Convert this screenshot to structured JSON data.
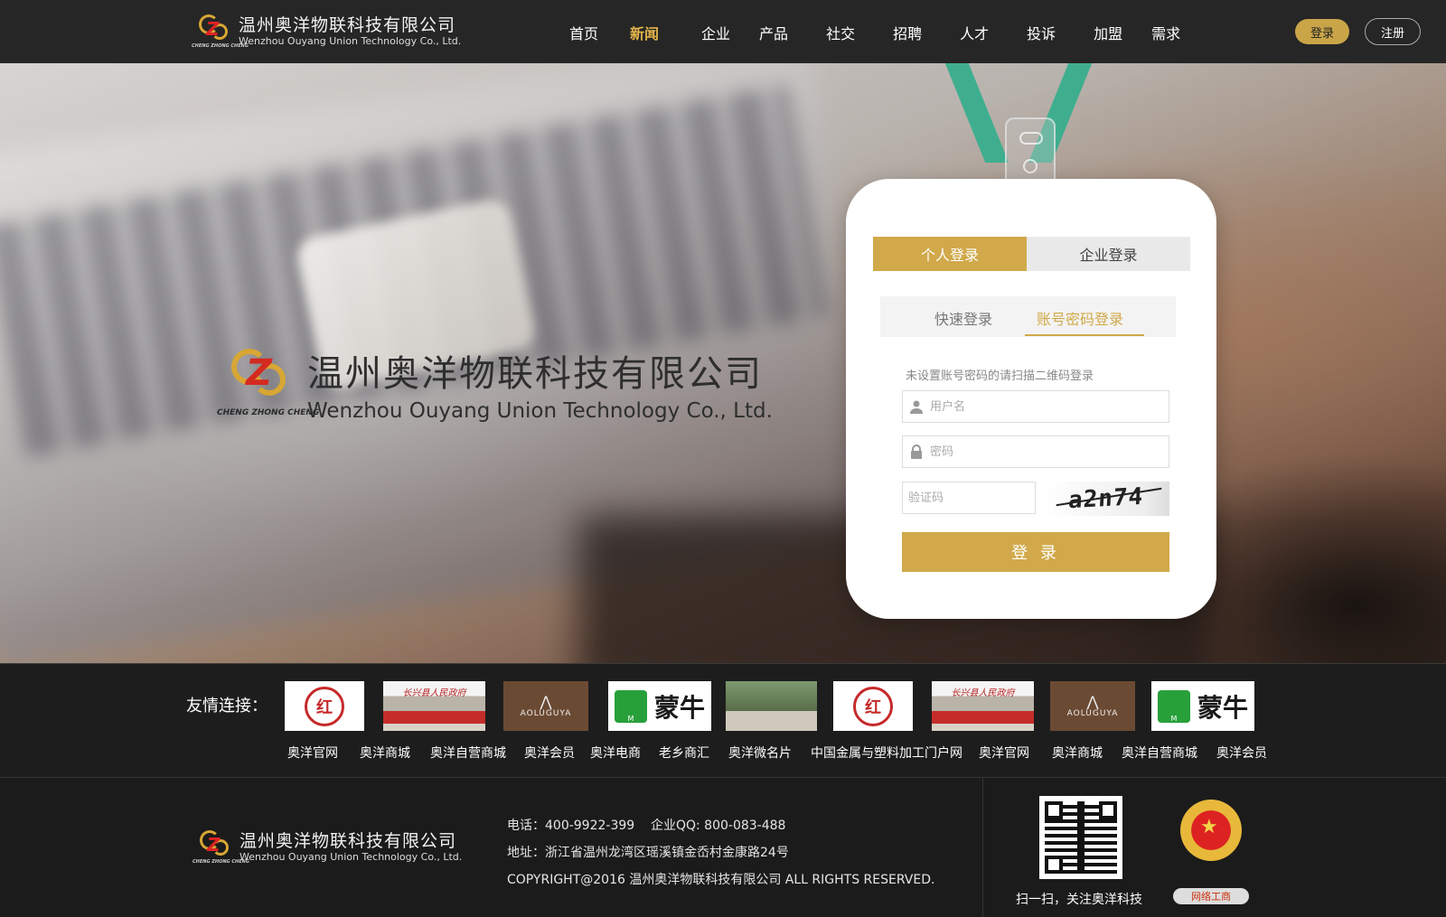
{
  "brand": {
    "name_cn": "温州奥洋物联科技有限公司",
    "name_en": "Wenzhou Ouyang Union Technology Co., Ltd.",
    "logo_tag": "CHENG ZHONG CHENG"
  },
  "nav": {
    "items": [
      {
        "label": "首页"
      },
      {
        "label": "新闻",
        "active": true
      },
      {
        "label": "企业"
      },
      {
        "label": "产品"
      },
      {
        "label": "社交"
      },
      {
        "label": "招聘"
      },
      {
        "label": "人才"
      },
      {
        "label": "投诉"
      },
      {
        "label": "加盟"
      },
      {
        "label": "需求"
      }
    ],
    "login_label": "登录",
    "register_label": "注册"
  },
  "login_card": {
    "tabs": {
      "personal": "个人登录",
      "enterprise": "企业登录"
    },
    "subtabs": {
      "quick": "快速登录",
      "account": "账号密码登录"
    },
    "hint": "未设置账号密码的请扫描二维码登录",
    "username_placeholder": "用户名",
    "password_placeholder": "密码",
    "captcha_placeholder": "验证码",
    "captcha_text": "a2n74",
    "submit_label": "登 录"
  },
  "links": {
    "title": "友情连接：",
    "logos": [
      {
        "name": "hongtou-logo",
        "text": "红"
      },
      {
        "name": "gate-logo",
        "text": "长兴县人民政府"
      },
      {
        "name": "aoluguya-logo",
        "text": "AOLUGUYA"
      },
      {
        "name": "mengniu-logo",
        "text": "蒙牛"
      },
      {
        "name": "park-gate-logo",
        "text": ""
      },
      {
        "name": "hongtou-logo",
        "text": "红"
      },
      {
        "name": "gate-logo",
        "text": "长兴县人民政府"
      },
      {
        "name": "aoluguya-logo",
        "text": "AOLUGUYA"
      },
      {
        "name": "mengniu-logo",
        "text": "蒙牛"
      }
    ],
    "names": [
      "奥洋官网",
      "奥洋商城",
      "奥洋自营商城",
      "奥洋会员",
      "奥洋电商",
      "老乡商汇",
      "奥洋微名片",
      "中国金属与塑料加工门户网",
      "奥洋官网",
      "奥洋商城",
      "奥洋自营商城",
      "奥洋会员"
    ]
  },
  "footer": {
    "phone_line": "电话：400-9922-399    企业QQ: 800-083-488",
    "address_line": "地址：浙江省温州龙湾区瑶溪镇金岙村金康路24号",
    "copyright_line": "COPYRIGHT@2016 温州奥洋物联科技有限公司 ALL RIGHTS RESERVED.",
    "qr_caption": "扫一扫，关注奥洋科技",
    "gs_badge": "网络工商"
  },
  "colors": {
    "accent_gold": "#d1a94a",
    "header_bg": "#262626",
    "lanyard_green": "#3fae8e"
  }
}
